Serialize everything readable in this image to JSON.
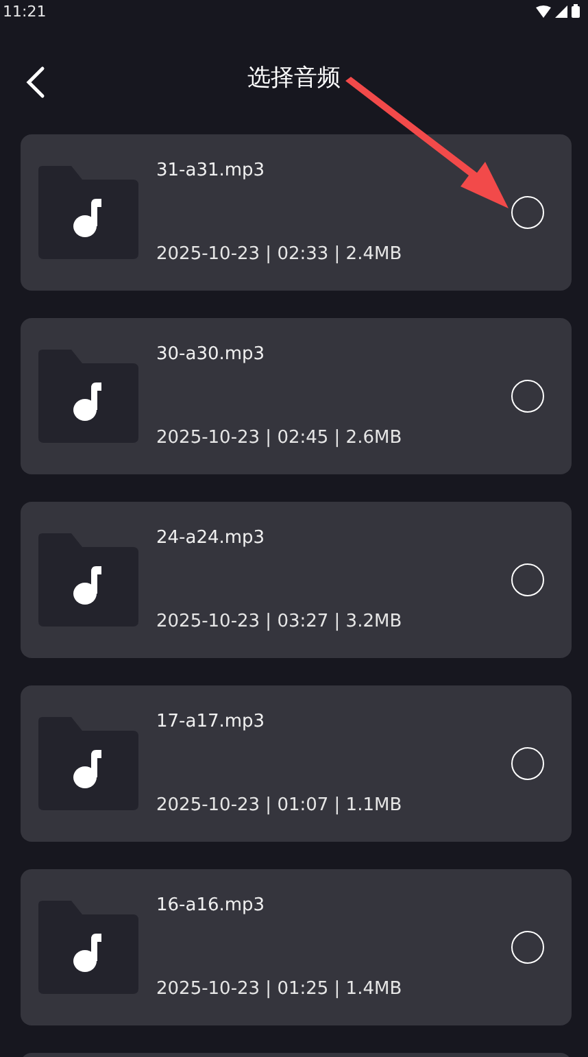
{
  "status_bar": {
    "time": "11:21"
  },
  "header": {
    "title": "选择音频"
  },
  "files": [
    {
      "name": "31-a31.mp3",
      "meta": "2025-10-23 | 02:33 | 2.4MB",
      "selected": false
    },
    {
      "name": "30-a30.mp3",
      "meta": "2025-10-23 | 02:45 | 2.6MB",
      "selected": false
    },
    {
      "name": "24-a24.mp3",
      "meta": "2025-10-23 | 03:27 | 3.2MB",
      "selected": false
    },
    {
      "name": "17-a17.mp3",
      "meta": "2025-10-23 | 01:07 | 1.1MB",
      "selected": false
    },
    {
      "name": "16-a16.mp3",
      "meta": "2025-10-23 | 01:25 | 1.4MB",
      "selected": false
    }
  ]
}
